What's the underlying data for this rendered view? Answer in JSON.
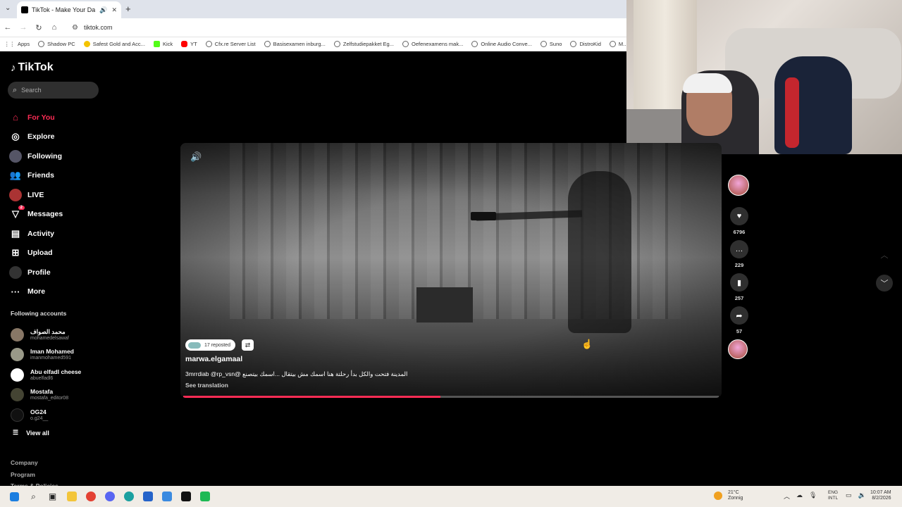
{
  "browser": {
    "tab_title": "TikTok - Make Your Day",
    "url": "tiktok.com",
    "apps_label": "Apps",
    "bookmarks": [
      "Shadow PC",
      "Safest Gold and Acc...",
      "Kick",
      "YT",
      "Cfx.re Server List",
      "Basisexamen inburg...",
      "Zelfstudiepakket Eg...",
      "Oefenexamens mak...",
      "Online Audio Conve...",
      "Suno",
      "DistroKid",
      "M..."
    ]
  },
  "sidebar": {
    "logo": "TikTok",
    "search_placeholder": "Search",
    "nav": [
      {
        "label": "For You",
        "icon": "home-icon"
      },
      {
        "label": "Explore",
        "icon": "compass-icon"
      },
      {
        "label": "Following",
        "icon": "following-avatar-icon"
      },
      {
        "label": "Friends",
        "icon": "friends-icon"
      },
      {
        "label": "LIVE",
        "icon": "live-icon"
      },
      {
        "label": "Messages",
        "icon": "messages-icon",
        "badge": "2"
      },
      {
        "label": "Activity",
        "icon": "activity-icon"
      },
      {
        "label": "Upload",
        "icon": "upload-icon"
      },
      {
        "label": "Profile",
        "icon": "profile-icon"
      },
      {
        "label": "More",
        "icon": "more-icon"
      }
    ],
    "following_title": "Following accounts",
    "following": [
      {
        "name": "محمد الصواف",
        "handle": "mohamedelsawaf"
      },
      {
        "name": "Iman Mohamed",
        "handle": "imanmohamed591"
      },
      {
        "name": "Abu elfadl cheese",
        "handle": "abuelfadl6"
      },
      {
        "name": "Mostafa",
        "handle": "mostafa_editor08"
      },
      {
        "name": "OG24",
        "handle": "o.g24__"
      }
    ],
    "view_all": "View all",
    "footer": [
      "Company",
      "Program",
      "Terms & Policies"
    ]
  },
  "video": {
    "repost_text": "17 reposted",
    "author": "marwa.elgamaal",
    "caption": "المدينة فتحت والكل بدأ رحلتة هنا اسمك مش بيتقال ...اسمك بيتصنع @3mrrdiab @rp_vsn",
    "see_translation": "See translation",
    "progress": 0.48
  },
  "actions": {
    "likes": "6796",
    "comments": "229",
    "saves": "257",
    "shares": "57"
  },
  "taskbar": {
    "temp": "21°C",
    "weather": "Zonnig",
    "lang1": "ENG",
    "lang2": "INTL",
    "time": "10:07 AM",
    "date": "8/2/2026"
  },
  "colors": {
    "accent": "#fe2c55",
    "background": "#000000"
  }
}
